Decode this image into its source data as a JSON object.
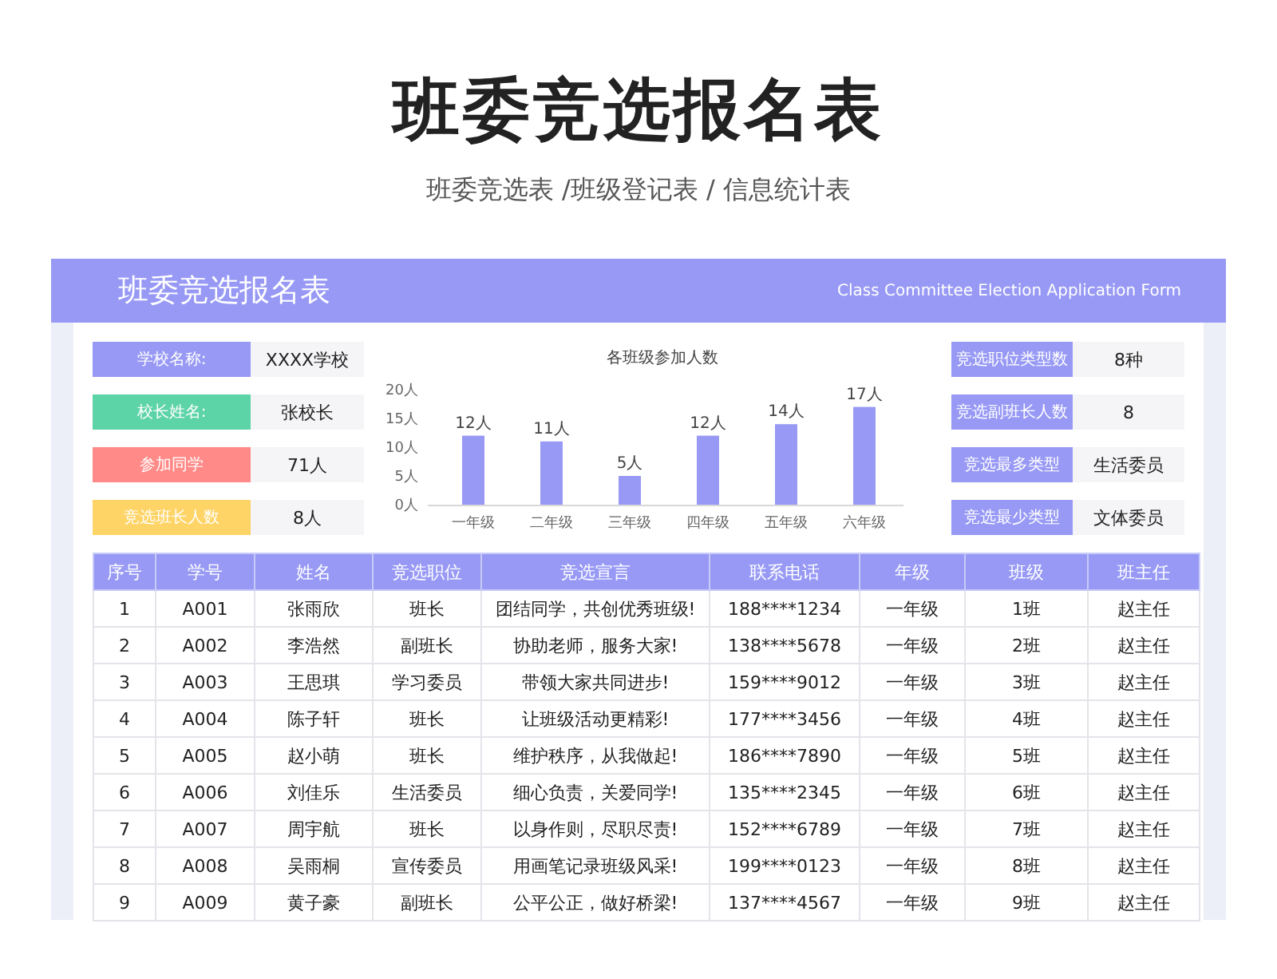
{
  "title": "班委竞选报名表",
  "subtitle": "班委竞选表 /班级登记表 / 信息统计表",
  "form": {
    "title": "班委竞选报名表",
    "subtitle": "Class Committee Election Application Form"
  },
  "left_info": [
    {
      "label": "学校名称:",
      "value": "XXXX学校",
      "color": "#9799f5"
    },
    {
      "label": "校长姓名:",
      "value": "张校长",
      "color": "#5dd3a8"
    },
    {
      "label": "参加同学",
      "value": "71人",
      "color": "#ff8a87"
    },
    {
      "label": "竞选班长人数",
      "value": "8人",
      "color": "#ffd466"
    }
  ],
  "chart": {
    "chart_data": {
      "type": "bar",
      "title": "各班级参加人数",
      "categories": [
        "一年级",
        "二年级",
        "三年级",
        "四年级",
        "五年级",
        "六年级"
      ],
      "series": [
        {
          "color": "#9799f5",
          "values": [
            12,
            11,
            5,
            12,
            14,
            17
          ]
        }
      ],
      "ylim": [
        0,
        20
      ],
      "yticks": [
        {
          "value": 0,
          "label": "0人"
        },
        {
          "value": 5,
          "label": "5人"
        },
        {
          "value": 10,
          "label": "10人"
        },
        {
          "value": 15,
          "label": "15人"
        },
        {
          "value": 20,
          "label": "20人"
        }
      ],
      "value_labels": [
        "12人",
        "11人",
        "5人",
        "12人",
        "14人",
        "17人"
      ]
    }
  },
  "right_info": [
    {
      "label": "竞选职位类型数",
      "value": "8种"
    },
    {
      "label": "竞选副班长人数",
      "value": "8"
    },
    {
      "label": "竞选最多类型",
      "value": "生活委员"
    },
    {
      "label": "竞选最少类型",
      "value": "文体委员"
    }
  ],
  "table": {
    "columns": [
      "序号",
      "学号",
      "姓名",
      "竞选职位",
      "竞选宣言",
      "联系电话",
      "年级",
      "班级",
      "班主任"
    ],
    "rows": [
      [
        "1",
        "A001",
        "张雨欣",
        "班长",
        "团结同学，共创优秀班级!",
        "188****1234",
        "一年级",
        "1班",
        "赵主任"
      ],
      [
        "2",
        "A002",
        "李浩然",
        "副班长",
        "协助老师，服务大家!",
        "138****5678",
        "一年级",
        "2班",
        "赵主任"
      ],
      [
        "3",
        "A003",
        "王思琪",
        "学习委员",
        "带领大家共同进步!",
        "159****9012",
        "一年级",
        "3班",
        "赵主任"
      ],
      [
        "4",
        "A004",
        "陈子轩",
        "班长",
        "让班级活动更精彩!",
        "177****3456",
        "一年级",
        "4班",
        "赵主任"
      ],
      [
        "5",
        "A005",
        "赵小萌",
        "班长",
        "维护秩序，从我做起!",
        "186****7890",
        "一年级",
        "5班",
        "赵主任"
      ],
      [
        "6",
        "A006",
        "刘佳乐",
        "生活委员",
        "细心负责，关爱同学!",
        "135****2345",
        "一年级",
        "6班",
        "赵主任"
      ],
      [
        "7",
        "A007",
        "周宇航",
        "班长",
        "以身作则，尽职尽责!",
        "152****6789",
        "一年级",
        "7班",
        "赵主任"
      ],
      [
        "8",
        "A008",
        "吴雨桐",
        "宣传委员",
        "用画笔记录班级风采!",
        "199****0123",
        "一年级",
        "8班",
        "赵主任"
      ],
      [
        "9",
        "A009",
        "黄子豪",
        "副班长",
        "公平公正，做好桥梁!",
        "137****4567",
        "一年级",
        "9班",
        "赵主任"
      ]
    ]
  }
}
